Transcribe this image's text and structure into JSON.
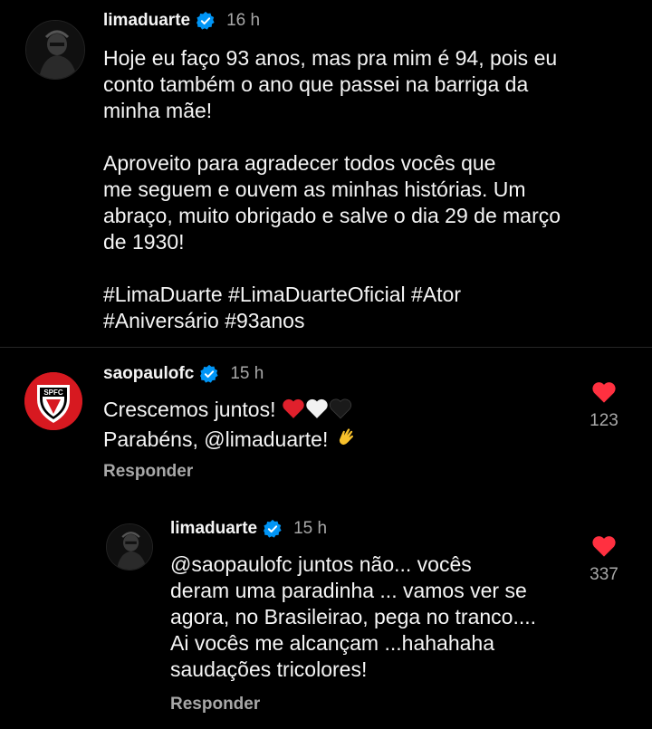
{
  "post": {
    "username": "limaduarte",
    "time": "16 h",
    "caption_p1": "Hoje eu faço 93 anos, mas pra mim é 94, pois eu\nconto também o ano que passei na barriga da\nminha mãe!",
    "caption_p2": "Aproveito para agradecer todos vocês que\nme seguem e ouvem as minhas histórias. Um\nabraço, muito obrigado e salve o dia 29 de março\nde 1930!",
    "caption_p3": "#LimaDuarte #LimaDuarteOficial #Ator\n#Aniversário #93anos"
  },
  "comment": {
    "username": "saopaulofc",
    "time": "15 h",
    "line1": "Crescemos juntos! ",
    "line2": "Parabéns, @limaduarte! ",
    "likes": "123",
    "reply_label": "Responder",
    "avatar_badge_text": "SPFC"
  },
  "reply": {
    "username": "limaduarte",
    "time": "15 h",
    "text": "@saopaulofc juntos não... vocês\nderam uma paradinha ... vamos ver se\nagora, no Brasileirao, pega no tranco....\nAi vocês me alcançam ...hahahaha\nsaudações tricolores!",
    "likes": "337",
    "reply_label": "Responder"
  },
  "colors": {
    "background": "#000000",
    "verified": "#0095f6",
    "like_heart": "#ff3040",
    "secondary_text": "#a8a8a8",
    "spfc_red": "#d71920"
  },
  "icons": [
    "verified-badge-icon",
    "heart-icon",
    "red-heart-emoji",
    "white-heart-emoji",
    "black-heart-emoji",
    "clapping-hand-emoji"
  ]
}
